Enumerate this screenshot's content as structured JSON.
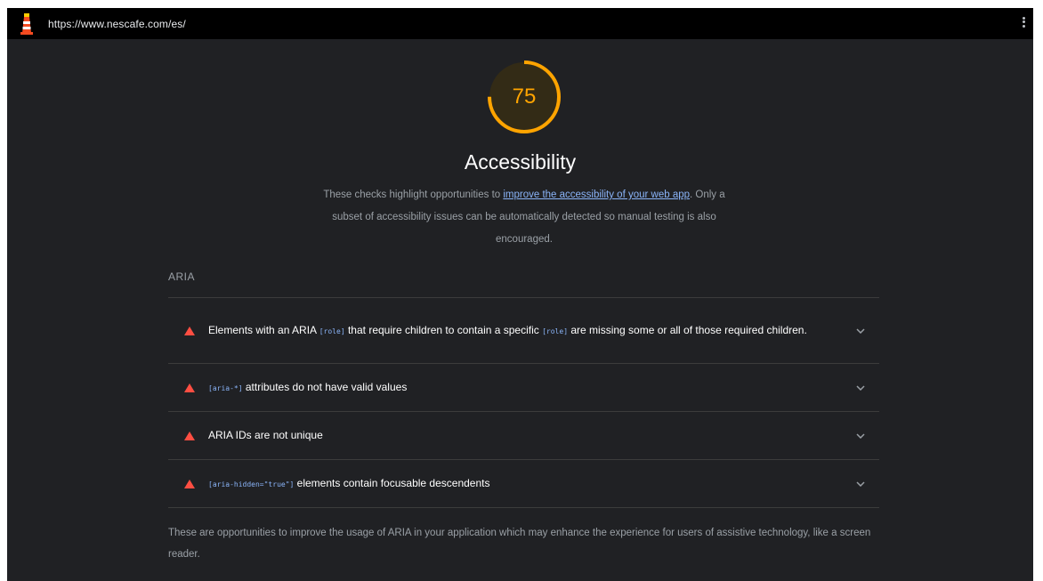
{
  "browser": {
    "url": "https://www.nescafe.com/es/",
    "logo_icon": "lighthouse-icon",
    "menu_icon": "more-vert-icon"
  },
  "score": {
    "value": "75",
    "fraction": 0.75,
    "color": "#ffa400"
  },
  "category": {
    "title": "Accessibility",
    "desc_before": "These checks highlight opportunities to ",
    "desc_link": "improve the accessibility of your web app",
    "desc_after": ". Only a subset of accessibility issues can be automatically detected so manual testing is also encouraged."
  },
  "group": {
    "title": "ARIA",
    "footer": "These are opportunities to improve the usage of ARIA in your application which may enhance the experience for users of assistive technology, like a screen reader."
  },
  "audits": [
    {
      "t1": "Elements with an ARIA ",
      "c1": "[role]",
      "t2": " that require children to contain a specific ",
      "c2": "[role]",
      "t3": " are missing some or all of those required children."
    },
    {
      "t1": "",
      "c1": "[aria-*]",
      "t2": " attributes do not have valid values"
    },
    {
      "t1": "ARIA IDs are not unique"
    },
    {
      "t1": "",
      "c1": "[aria-hidden=\"true\"]",
      "t2": " elements contain focusable descendents"
    }
  ],
  "colors": {
    "fail": "#ff4e42",
    "link": "#8ab4f8",
    "average": "#ffa400"
  }
}
